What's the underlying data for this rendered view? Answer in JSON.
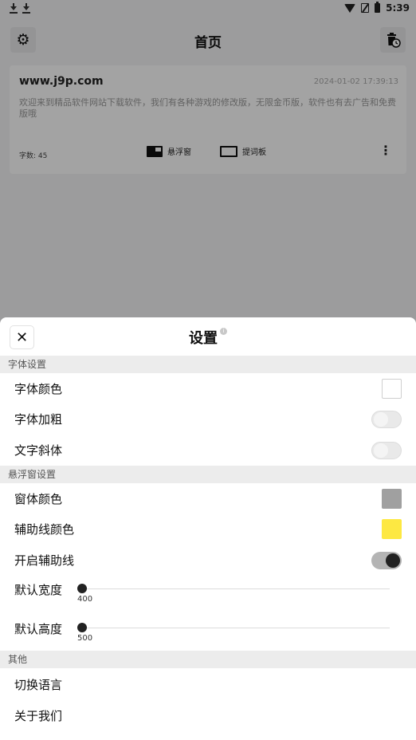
{
  "status_bar": {
    "time": "5:39"
  },
  "home": {
    "title": "首页",
    "card": {
      "site": "www.j9p.com",
      "time": "2024-01-02 17:39:13",
      "text": "欢迎来到精品软件网站下载软件，我们有各种游戏的修改版，无限金币版，软件也有去广告和免费版哦",
      "count_label": "字数: 45",
      "float_label": "悬浮窗",
      "prompter_label": "提词板"
    }
  },
  "settings": {
    "title": "设置",
    "font_section": {
      "header": "字体设置",
      "font_color_label": "字体颜色",
      "font_color": "#ffffff",
      "bold_label": "字体加粗",
      "bold_on": false,
      "italic_label": "文字斜体",
      "italic_on": false
    },
    "float_section": {
      "header": "悬浮窗设置",
      "window_color_label": "窗体颜色",
      "window_color": "#a0a0a0",
      "guide_color_label": "辅助线颜色",
      "guide_color": "#fde842",
      "guide_enable_label": "开启辅助线",
      "guide_enable_on": true,
      "width_label": "默认宽度",
      "width_value": "400",
      "width_fraction": 0.0,
      "height_label": "默认高度",
      "height_value": "500",
      "height_fraction": 0.0
    },
    "other_section": {
      "header": "其他",
      "language_label": "切换语言",
      "about_label": "关于我们"
    }
  }
}
